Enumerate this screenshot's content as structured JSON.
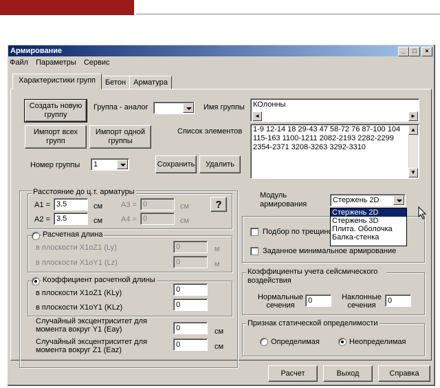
{
  "window": {
    "title": "Армирование"
  },
  "menu": {
    "file": "Файл",
    "params": "Параметры",
    "service": "Сервис"
  },
  "tabs": [
    "Характеристики групп",
    "Бетон",
    "Арматура"
  ],
  "top": {
    "create_group": "Создать новую группу",
    "group_analog_label": "Группа - аналог",
    "group_name_label": "Имя группы",
    "group_name_value": "КОлонны",
    "import_all": "Импорт всех групп",
    "import_one": "Импорт одной группы",
    "elements_label": "Список элементов",
    "elements_value": "1-9 12-14 18 29-43 47 58-72 76 87-100 104 115-163 1100-1211 2082-2193 2282-2299 2354-2371 3208-3263 3292-3310",
    "group_number_label": "Номер группы",
    "group_number_value": "1",
    "save": "Сохранить",
    "delete": "Удалить"
  },
  "distance": {
    "legend": "Расстояние до ц.т. арматуры",
    "a1_label": "A1 =",
    "a1_value": "3.5",
    "a1_unit": "см",
    "a2_label": "A2 =",
    "a2_value": "3.5",
    "a2_unit": "см",
    "a3_label": "A3 =",
    "a3_value": "0",
    "a3_unit": "см",
    "a4_label": "A4 =",
    "a4_value": "0",
    "a4_unit": "см",
    "help": "?"
  },
  "calc_length": {
    "legend": "Расчетная длина",
    "ly_label": "в плоскости X1oZ1 (Ly)",
    "ly_value": "0",
    "ly_unit": "м",
    "lz_label": "в плоскости X1oY1 (Lz)",
    "lz_value": "0",
    "lz_unit": "м"
  },
  "coef_length": {
    "legend": "Коэффициент расчетной длины",
    "kly_label": "в плоскости X1oZ1 (KLy)",
    "kly_value": "0",
    "klz_label": "в плоскости X1oY1 (KLz)",
    "klz_value": "0"
  },
  "eccentricity": {
    "eay_label": "Случайный эксцентриситет для момента вокруг Y1 (Eay)",
    "eay_value": "0",
    "eay_unit": "см",
    "eaz_label": "Случайный эксцентриситет для момента вокруг Z1 (Eaz)",
    "eaz_value": "0",
    "eaz_unit": "см"
  },
  "module": {
    "label": "Модуль армирования",
    "selected": "Стержень 2D",
    "options": [
      "Стержень 2D",
      "Стержень 3D",
      "Плита. Оболочка",
      "Балка-стенка"
    ]
  },
  "checks": {
    "crack": "Подбор по трещино",
    "minimal": "Заданное минимальное армирование"
  },
  "seismic": {
    "legend": "Коэффициенты учета сейсмического воздействия",
    "normal_label": "Нормальные сечения",
    "normal_value": "0",
    "inclined_label": "Наклонные сечения",
    "inclined_value": "0"
  },
  "static": {
    "legend": "Признак статической определимости",
    "defined": "Определимая",
    "undefined": "Неопределимая"
  },
  "bottom": {
    "calc": "Расчет",
    "exit": "Выход",
    "help": "Справка"
  }
}
